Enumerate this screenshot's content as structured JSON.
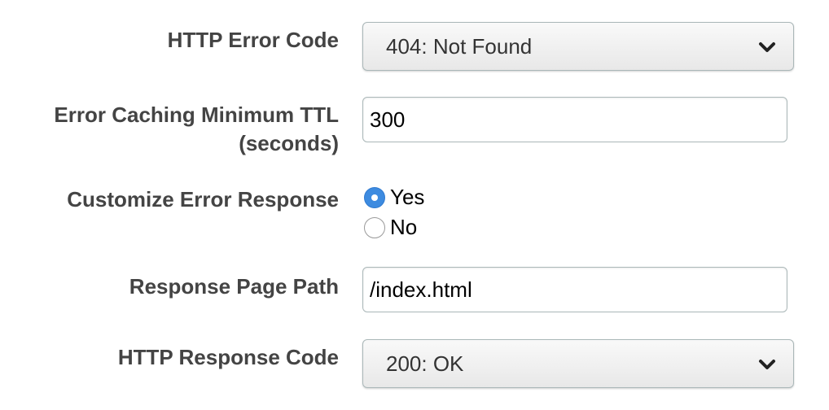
{
  "fields": {
    "http_error_code": {
      "label": "HTTP Error Code",
      "value": "404: Not Found",
      "icon": "chevron-down-icon"
    },
    "error_caching_ttl": {
      "label_line1": "Error Caching Minimum TTL",
      "label_line2": "(seconds)",
      "value": "300"
    },
    "customize_error_response": {
      "label": "Customize Error Response",
      "options": [
        {
          "label": "Yes",
          "checked": true
        },
        {
          "label": "No",
          "checked": false
        }
      ]
    },
    "response_page_path": {
      "label": "Response Page Path",
      "value": "/index.html"
    },
    "http_response_code": {
      "label": "HTTP Response Code",
      "value": "200: OK",
      "icon": "chevron-down-icon"
    }
  },
  "colors": {
    "label_text": "#444444",
    "radio_selected": "#3d8be0",
    "field_border": "#aab7b8"
  }
}
